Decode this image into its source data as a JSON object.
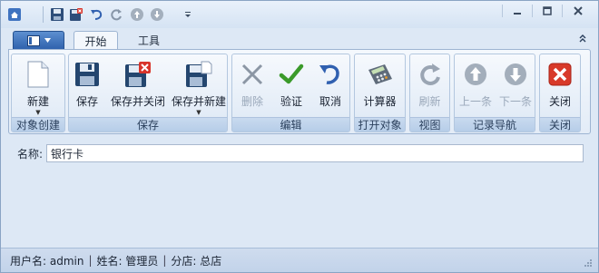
{
  "titlebar": {
    "quick_access": [
      "home-icon",
      "save-icon",
      "save-close-icon",
      "undo-icon",
      "refresh-icon",
      "up-icon",
      "down-icon",
      "customize-icon"
    ],
    "window_buttons": [
      "minimize-icon",
      "maximize-icon",
      "close-icon"
    ]
  },
  "tabs": {
    "start": "开始",
    "tools": "工具"
  },
  "ribbon": {
    "groups": {
      "create": {
        "label": "对象创建",
        "new": "新建"
      },
      "save": {
        "label": "保存",
        "save": "保存",
        "save_close": "保存并关闭",
        "save_new": "保存并新建"
      },
      "edit": {
        "label": "编辑",
        "delete": "删除",
        "validate": "验证",
        "cancel": "取消"
      },
      "open": {
        "label": "打开对象",
        "calculator": "计算器"
      },
      "view": {
        "label": "视图",
        "refresh": "刷新"
      },
      "nav": {
        "label": "记录导航",
        "prev": "上一条",
        "next": "下一条"
      },
      "close": {
        "label": "关闭",
        "close": "关闭"
      }
    }
  },
  "form": {
    "name_label": "名称:",
    "name_value": "银行卡"
  },
  "status": {
    "username": "用户名: admin",
    "fullname": "姓名: 管理员",
    "branch": "分店: 总店",
    "separator": "|"
  },
  "colors": {
    "accent": "#2f62ad",
    "ribbon_bg": "#e3ecf7",
    "check_green": "#3a9a2a",
    "close_red": "#d83a2a"
  }
}
